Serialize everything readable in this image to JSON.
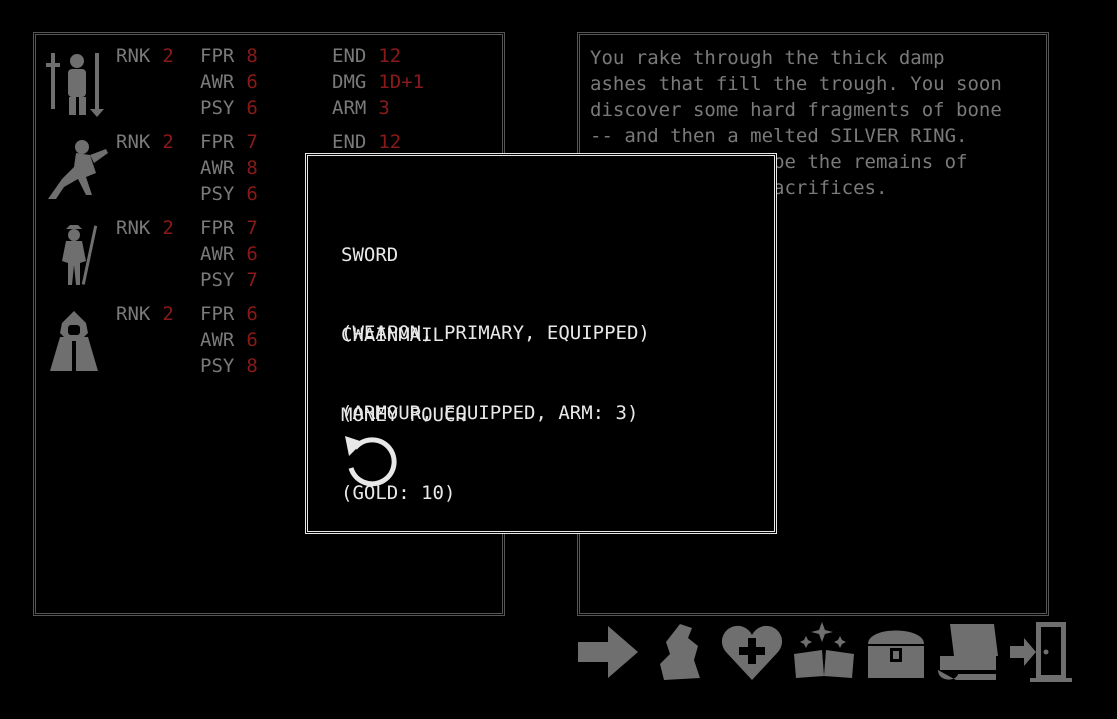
{
  "party": [
    {
      "icon": "warrior-party-icon",
      "stats": [
        {
          "label": "RNK",
          "value": "2"
        },
        {
          "label": "FPR",
          "value": "8"
        },
        {
          "label": "AWR",
          "value": "6"
        },
        {
          "label": "PSY",
          "value": "6"
        },
        {
          "label": "END",
          "value": "12"
        },
        {
          "label": "DMG",
          "value": "1D+1"
        },
        {
          "label": "ARM",
          "value": "3"
        }
      ]
    },
    {
      "icon": "trickster-icon",
      "stats": [
        {
          "label": "RNK",
          "value": "2"
        },
        {
          "label": "FPR",
          "value": "7"
        },
        {
          "label": "AWR",
          "value": "8"
        },
        {
          "label": "PSY",
          "value": "6"
        },
        {
          "label": "END",
          "value": "12"
        }
      ]
    },
    {
      "icon": "sage-icon",
      "stats": [
        {
          "label": "RNK",
          "value": "2"
        },
        {
          "label": "FPR",
          "value": "7"
        },
        {
          "label": "AWR",
          "value": "6"
        },
        {
          "label": "PSY",
          "value": "7"
        }
      ]
    },
    {
      "icon": "enchanter-icon",
      "stats": [
        {
          "label": "RNK",
          "value": "2"
        },
        {
          "label": "FPR",
          "value": "6"
        },
        {
          "label": "AWR",
          "value": "6"
        },
        {
          "label": "PSY",
          "value": "8"
        }
      ]
    }
  ],
  "narrative": "You rake through the thick damp\nashes that fill the trough. You soon\ndiscover some hard fragments of bone\n-- and then a melted SILVER RING.\n                be the remains of\n                acrifices.",
  "modal": {
    "items": [
      {
        "name": "SWORD",
        "details": "(WEAPON, PRIMARY, EQUIPPED)"
      },
      {
        "name": "CHAINMAIL",
        "details": "(ARMOUR, EQUIPPED, ARM: 3)"
      },
      {
        "name": "MONEY POUCH",
        "details": "(GOLD: 10)"
      }
    ],
    "back_icon": "undo-arrow-icon"
  },
  "toolbar": [
    "continue-arrow-icon",
    "map-icon",
    "heal-heart-icon",
    "spellbook-icon",
    "treasure-chest-icon",
    "codeword-book-icon",
    "exit-door-icon"
  ],
  "colors": {
    "stat_value": "#8a1a1a",
    "text": "#7a7a7a",
    "modal_text": "#e8e8e8",
    "border": "#565656"
  }
}
